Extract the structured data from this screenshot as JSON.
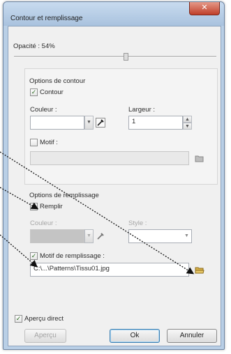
{
  "window": {
    "title": "Contour et remplissage",
    "close_glyph": "✕"
  },
  "opacity": {
    "label": "Opacité : 54%",
    "value_percent": 54
  },
  "contour_options": {
    "heading": "Options de contour",
    "contour_checkbox": "Contour",
    "color_label": "Couleur :",
    "width_label": "Largeur :",
    "width_value": "1",
    "pattern_checkbox": "Motif :",
    "pattern_value": ""
  },
  "fill_options": {
    "heading": "Options de remplissage",
    "fill_checkbox": "Remplir",
    "color_label": "Couleur :",
    "style_label": "Style :",
    "style_value": "",
    "pattern_checkbox": "Motif de remplissage :",
    "pattern_value": "C:\\...\\Patterns\\Tissu01.jpg"
  },
  "live_preview_checkbox": "Aperçu direct",
  "buttons": {
    "preview": "Aperçu",
    "ok": "Ok",
    "cancel": "Annuler"
  },
  "colors": {
    "accent": "#3c7fb1",
    "pen": "#2b2b2b",
    "folder": "#d8b14a"
  }
}
